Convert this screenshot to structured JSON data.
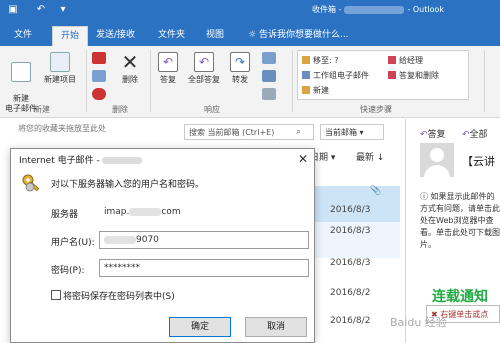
{
  "titlebar": {
    "title_prefix": "收件箱 -",
    "title_suffix": "- Outlook",
    "accent_color": "#2b72c2"
  },
  "tabs": [
    {
      "label": "文件"
    },
    {
      "label": "开始"
    },
    {
      "label": "发送/接收"
    },
    {
      "label": "文件夹"
    },
    {
      "label": "视图"
    },
    {
      "label": "告诉我你想要做什么..."
    }
  ],
  "ribbon": {
    "new_email": "新建\n电子邮件",
    "new_item": "新建项目",
    "group_new": "新建",
    "delete": "删除",
    "group_delete": "删除",
    "reply": "答复",
    "reply_all": "全部答复",
    "forward": "转发",
    "group_respond": "响应",
    "quick_steps": [
      "移至: ?",
      "工作组电子邮件",
      "新建",
      "给经理",
      "答复和删除"
    ],
    "group_quicksteps": "快速步骤"
  },
  "nav": {
    "favorites_hint": "将您的收藏夹拖放至此处"
  },
  "search": {
    "placeholder": "搜索 当前邮箱 (Ctrl+E)",
    "scope": "当前邮箱"
  },
  "list": {
    "sort_label": "日期",
    "order_label": "最新",
    "dates": [
      "2016/8/3",
      "2016/8/3",
      "2016/8/3",
      "2016/8/2",
      "2016/8/2"
    ]
  },
  "reading_pane": {
    "reply": "答复",
    "reply_all": "全部",
    "subject": "【云讲",
    "info": "如果显示此邮件的方式有问题，请单击此处在Web浏览器中查看。单击此处可下载图片。",
    "image_text": "右键单击或点"
  },
  "dialog": {
    "title": "Internet 电子邮件 -",
    "prompt": "对以下服务器输入您的用户名和密码。",
    "server_label": "服务器",
    "server_value": "imap.",
    "server_value_suffix": "com",
    "username_label": "用户名(U):",
    "username_value": "",
    "username_suffix": "9070",
    "password_label": "密码(P):",
    "password_value": "********",
    "remember_label": "将密码保存在密码列表中(S)",
    "ok": "确定",
    "cancel": "取消"
  },
  "watermark": {
    "caption": "连载通知",
    "site": "Baidu 经验"
  }
}
